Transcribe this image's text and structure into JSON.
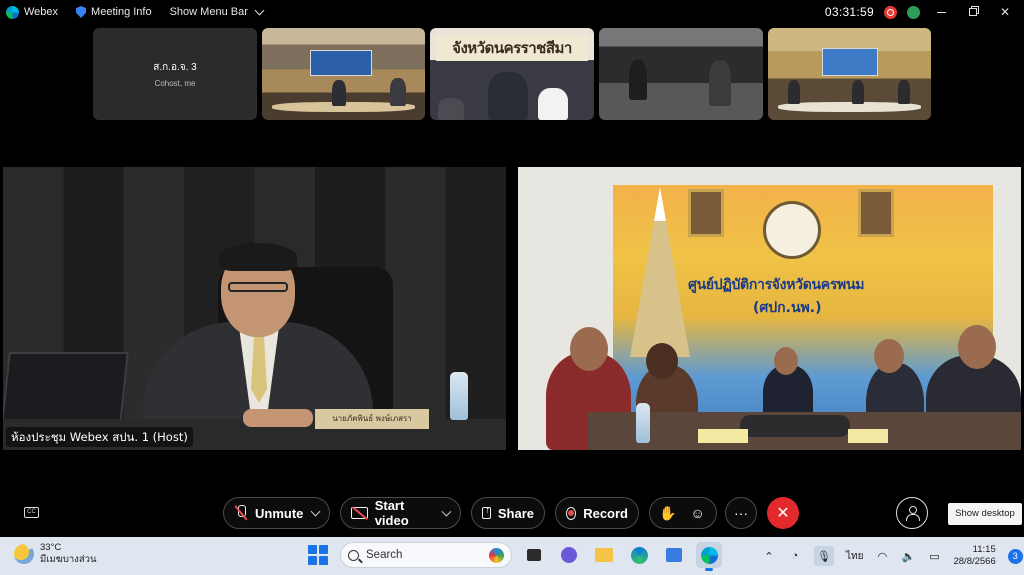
{
  "topbar": {
    "app_name": "Webex",
    "meeting_info": "Meeting Info",
    "show_menu_bar": "Show Menu Bar",
    "clock": "03:31:59"
  },
  "self_view": {
    "name": "ส.ก.อ.จ. 3",
    "subtitle": "Cohost, me"
  },
  "thumbnails": {
    "banner_2": "จังหวัดนครราชสีมา"
  },
  "main_left": {
    "host_label": "ห้องประชุม Webex สปน. 1 (Host)",
    "nameplate": "นายภัคพินธ์ พงษ์เภสรา"
  },
  "main_right": {
    "title": "ศูนย์ปฏิบัติการจังหวัดนครพนม",
    "subtitle": "(ศปก.นพ.)"
  },
  "controls": {
    "unmute": "Unmute",
    "start_video": "Start video",
    "share": "Share",
    "record": "Record",
    "more": "···",
    "show_desktop": "Show desktop"
  },
  "taskbar": {
    "temperature": "33°C",
    "weather_desc": "มีเมฆบางส่วน",
    "search_placeholder": "Search",
    "language": "ไทย",
    "time": "11:15",
    "date": "28/8/2566",
    "notification_count": "3"
  }
}
